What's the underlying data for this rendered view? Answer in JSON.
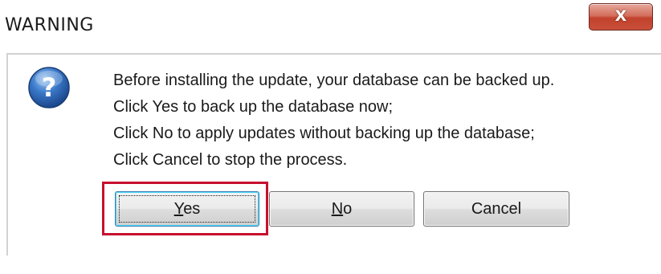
{
  "window": {
    "title": "WARNING",
    "close_label": "X"
  },
  "icon": {
    "name": "question-icon",
    "color": "#2a5fa8"
  },
  "message": {
    "lines": [
      "Before installing the update, your database can be backed up.",
      "Click Yes to back up the database now;",
      "Click No to apply updates without backing up the database;",
      "Click Cancel to stop the process."
    ]
  },
  "buttons": {
    "yes": {
      "mnemonic": "Y",
      "rest": "es"
    },
    "no": {
      "mnemonic": "N",
      "rest": "o"
    },
    "cancel": {
      "label": "Cancel"
    }
  },
  "annotation": {
    "highlight_color": "#c8102e"
  }
}
